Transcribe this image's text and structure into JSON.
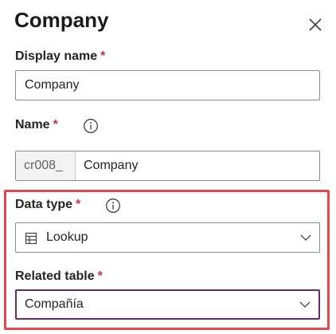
{
  "panel": {
    "title": "Company",
    "close_icon": "close-icon"
  },
  "display_name": {
    "label": "Display name",
    "required_mark": "*",
    "value": "Company"
  },
  "name": {
    "label": "Name",
    "required_mark": "*",
    "info_icon": "info-icon",
    "prefix": "cr008_",
    "value": "Company"
  },
  "data_type": {
    "label": "Data type",
    "required_mark": "*",
    "info_icon": "info-icon",
    "selected_icon": "table-icon",
    "selected": "Lookup"
  },
  "related_table": {
    "label": "Related table",
    "required_mark": "*",
    "selected": "Compañía"
  },
  "colors": {
    "required": "#c4314b",
    "highlight_border": "#e8484d",
    "focus_border": "#6b2a6b"
  }
}
